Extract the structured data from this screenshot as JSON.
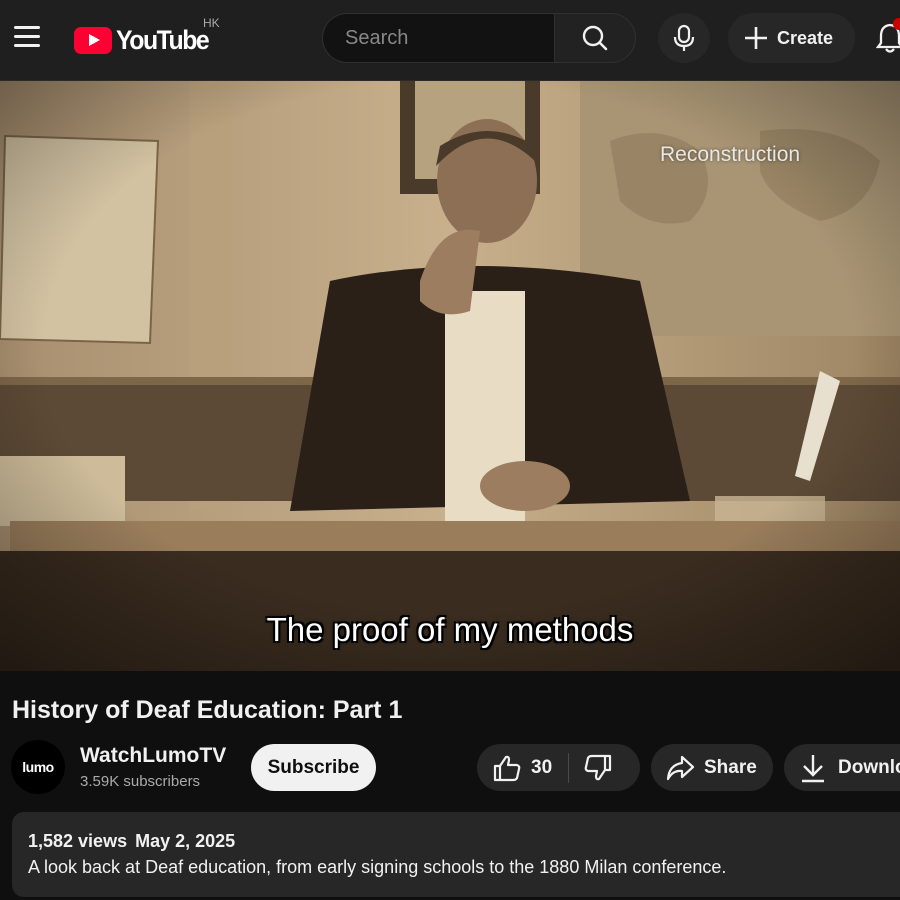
{
  "header": {
    "logo_text": "YouTube",
    "region": "HK",
    "search_placeholder": "Search",
    "create_label": "Create"
  },
  "video": {
    "caption": "The proof of my methods",
    "overlay_text": "Reconstruction"
  },
  "title": "History of Deaf Education: Part 1",
  "channel": {
    "avatar_text": "lumo",
    "name": "WatchLumoTV",
    "subscribers": "3.59K subscribers"
  },
  "actions": {
    "subscribe": "Subscribe",
    "likes": "30",
    "share": "Share",
    "download": "Download"
  },
  "description": {
    "views": "1,582 views",
    "date": "May 2, 2025",
    "text": "A look back at Deaf education, from early signing schools to the 1880 Milan conference."
  },
  "colors": {
    "brand_red": "#ff0033",
    "background": "#0f0f0f",
    "surface": "#272727"
  }
}
